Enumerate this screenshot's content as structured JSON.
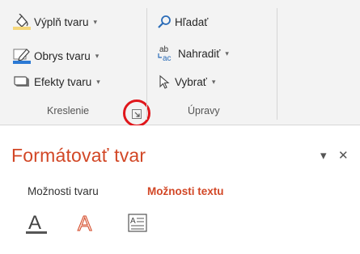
{
  "ribbon": {
    "drawing_group": {
      "label": "Kreslenie",
      "buttons": [
        {
          "label": "Výplň tvaru",
          "icon": "paint-bucket-icon"
        },
        {
          "label": "Obrys tvaru",
          "icon": "pencil-outline-icon"
        },
        {
          "label": "Efekty tvaru",
          "icon": "shape-effects-icon"
        }
      ],
      "launcher_icon": "dialog-launcher-icon"
    },
    "editing_group": {
      "label": "Úpravy",
      "buttons": [
        {
          "label": "Hľadať",
          "icon": "search-icon"
        },
        {
          "label": "Nahradiť",
          "icon": "replace-icon"
        },
        {
          "label": "Vybrať",
          "icon": "select-cursor-icon"
        }
      ]
    },
    "highlight_color": "#e0161b"
  },
  "pane": {
    "title": "Formátovať tvar",
    "dropdown_glyph": "▾",
    "close_glyph": "✕",
    "tabs": [
      {
        "label": "Možnosti tvaru",
        "active": false
      },
      {
        "label": "Možnosti textu",
        "active": true
      }
    ],
    "icons": [
      "text-fill-outline-icon",
      "text-effects-icon",
      "textbox-icon"
    ],
    "accent_color": "#d24726"
  }
}
